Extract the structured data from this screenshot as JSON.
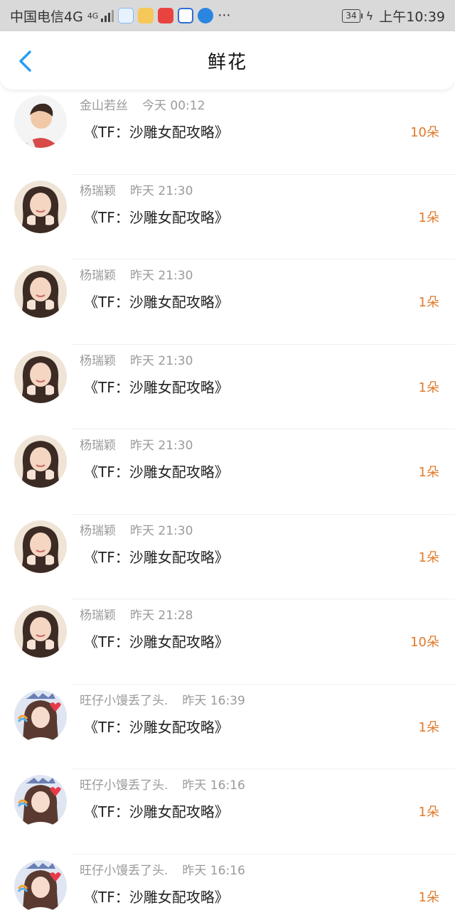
{
  "status_bar": {
    "carrier": "中国电信4G",
    "network_small": "4G",
    "battery": "34",
    "time": "上午10:39",
    "more": "···"
  },
  "header": {
    "title": "鲜花"
  },
  "colors": {
    "accent_orange": "#e07a2a",
    "back_blue": "#2a9df4"
  },
  "items": [
    {
      "name": "金山若丝",
      "time": "今天 00:12",
      "book": "《TF：沙雕女配攻略》",
      "count": "10朵",
      "avatar": "boy"
    },
    {
      "name": "杨瑞颖",
      "time": "昨天 21:30",
      "book": "《TF：沙雕女配攻略》",
      "count": "1朵",
      "avatar": "girl"
    },
    {
      "name": "杨瑞颖",
      "time": "昨天 21:30",
      "book": "《TF：沙雕女配攻略》",
      "count": "1朵",
      "avatar": "girl"
    },
    {
      "name": "杨瑞颖",
      "time": "昨天 21:30",
      "book": "《TF：沙雕女配攻略》",
      "count": "1朵",
      "avatar": "girl"
    },
    {
      "name": "杨瑞颖",
      "time": "昨天 21:30",
      "book": "《TF：沙雕女配攻略》",
      "count": "1朵",
      "avatar": "girl"
    },
    {
      "name": "杨瑞颖",
      "time": "昨天 21:30",
      "book": "《TF：沙雕女配攻略》",
      "count": "1朵",
      "avatar": "girl"
    },
    {
      "name": "杨瑞颖",
      "time": "昨天 21:28",
      "book": "《TF：沙雕女配攻略》",
      "count": "10朵",
      "avatar": "girl"
    },
    {
      "name": "旺仔小馒丢了头.",
      "time": "昨天 16:39",
      "book": "《TF：沙雕女配攻略》",
      "count": "1朵",
      "avatar": "girl2"
    },
    {
      "name": "旺仔小馒丢了头.",
      "time": "昨天 16:16",
      "book": "《TF：沙雕女配攻略》",
      "count": "1朵",
      "avatar": "girl2"
    },
    {
      "name": "旺仔小馒丢了头.",
      "time": "昨天 16:16",
      "book": "《TF：沙雕女配攻略》",
      "count": "1朵",
      "avatar": "girl2"
    }
  ]
}
